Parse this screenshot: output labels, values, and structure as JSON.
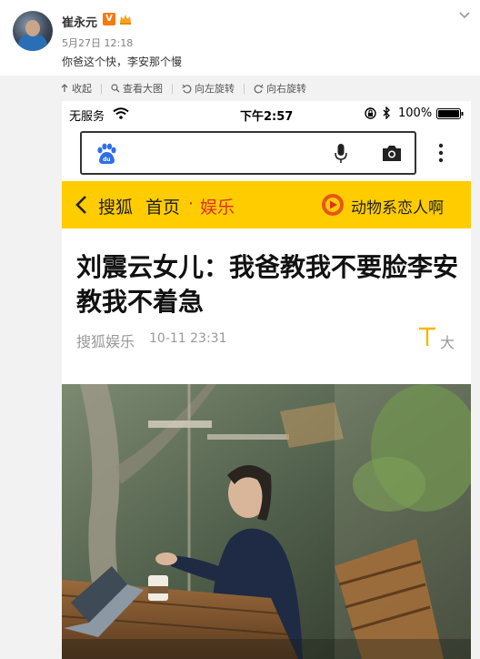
{
  "post": {
    "username": "崔永元",
    "vip_badge": "V",
    "timestamp": "5月27日 12:18",
    "text": "你爸这个快，李安那个慢"
  },
  "toolbar": {
    "collapse": "收起",
    "view_large": "查看大图",
    "rotate_left": "向左旋转",
    "rotate_right": "向右旋转"
  },
  "phone": {
    "status": {
      "carrier": "无服务",
      "time": "下午2:57",
      "battery": "100%"
    },
    "nav": {
      "sohu": "搜狐",
      "home": "首页",
      "dot": "·",
      "channel": "娱乐",
      "promo": "动物系恋人啊"
    },
    "article": {
      "title": "刘震云女儿：我爸教我不要脸李安教我不着急",
      "source": "搜狐娱乐",
      "time": "10-11 23:31",
      "font_size": "大"
    }
  },
  "colors": {
    "nav_bg": "#ffcc00",
    "channel": "#d9322b",
    "baidu_blue": "#2d6fe6"
  }
}
